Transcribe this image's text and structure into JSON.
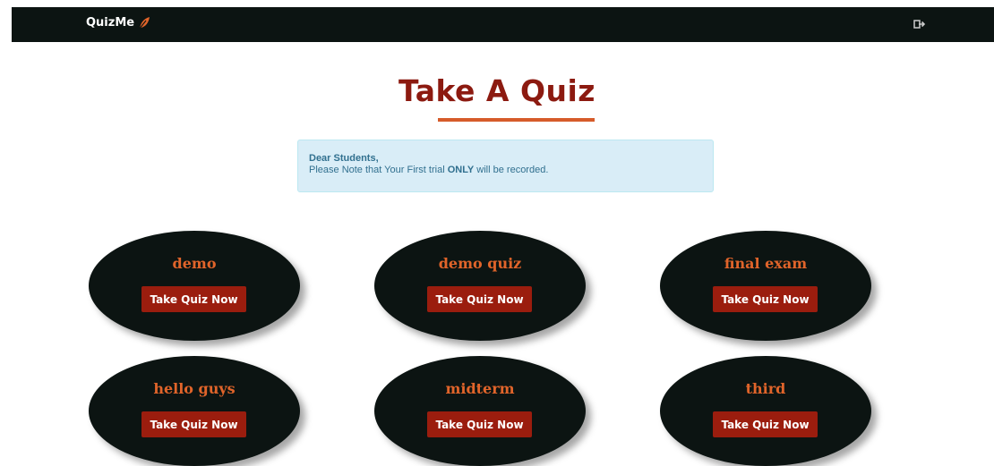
{
  "navbar": {
    "brand": "QuizMe",
    "brand_icon": "leaf-icon",
    "logout_icon": "sign-out-icon"
  },
  "page": {
    "title": "Take A Quiz"
  },
  "alert": {
    "heading": "Dear Students,",
    "text_before": "Please Note that Your First trial ",
    "emphasis": "ONLY",
    "text_after": " will be recorded."
  },
  "quizzes": [
    {
      "name": "demo",
      "button_label": "Take Quiz Now"
    },
    {
      "name": "demo quiz",
      "button_label": "Take Quiz Now"
    },
    {
      "name": "final exam",
      "button_label": "Take Quiz Now"
    },
    {
      "name": "hello guys",
      "button_label": "Take Quiz Now"
    },
    {
      "name": "midterm",
      "button_label": "Take Quiz Now"
    },
    {
      "name": "third",
      "button_label": "Take Quiz Now"
    }
  ],
  "colors": {
    "navbar_bg": "#0c1412",
    "title": "#8c1a10",
    "accent": "#d65b2a",
    "button": "#9b1d0e",
    "alert_bg": "#d9edf7",
    "alert_text": "#31708f"
  }
}
